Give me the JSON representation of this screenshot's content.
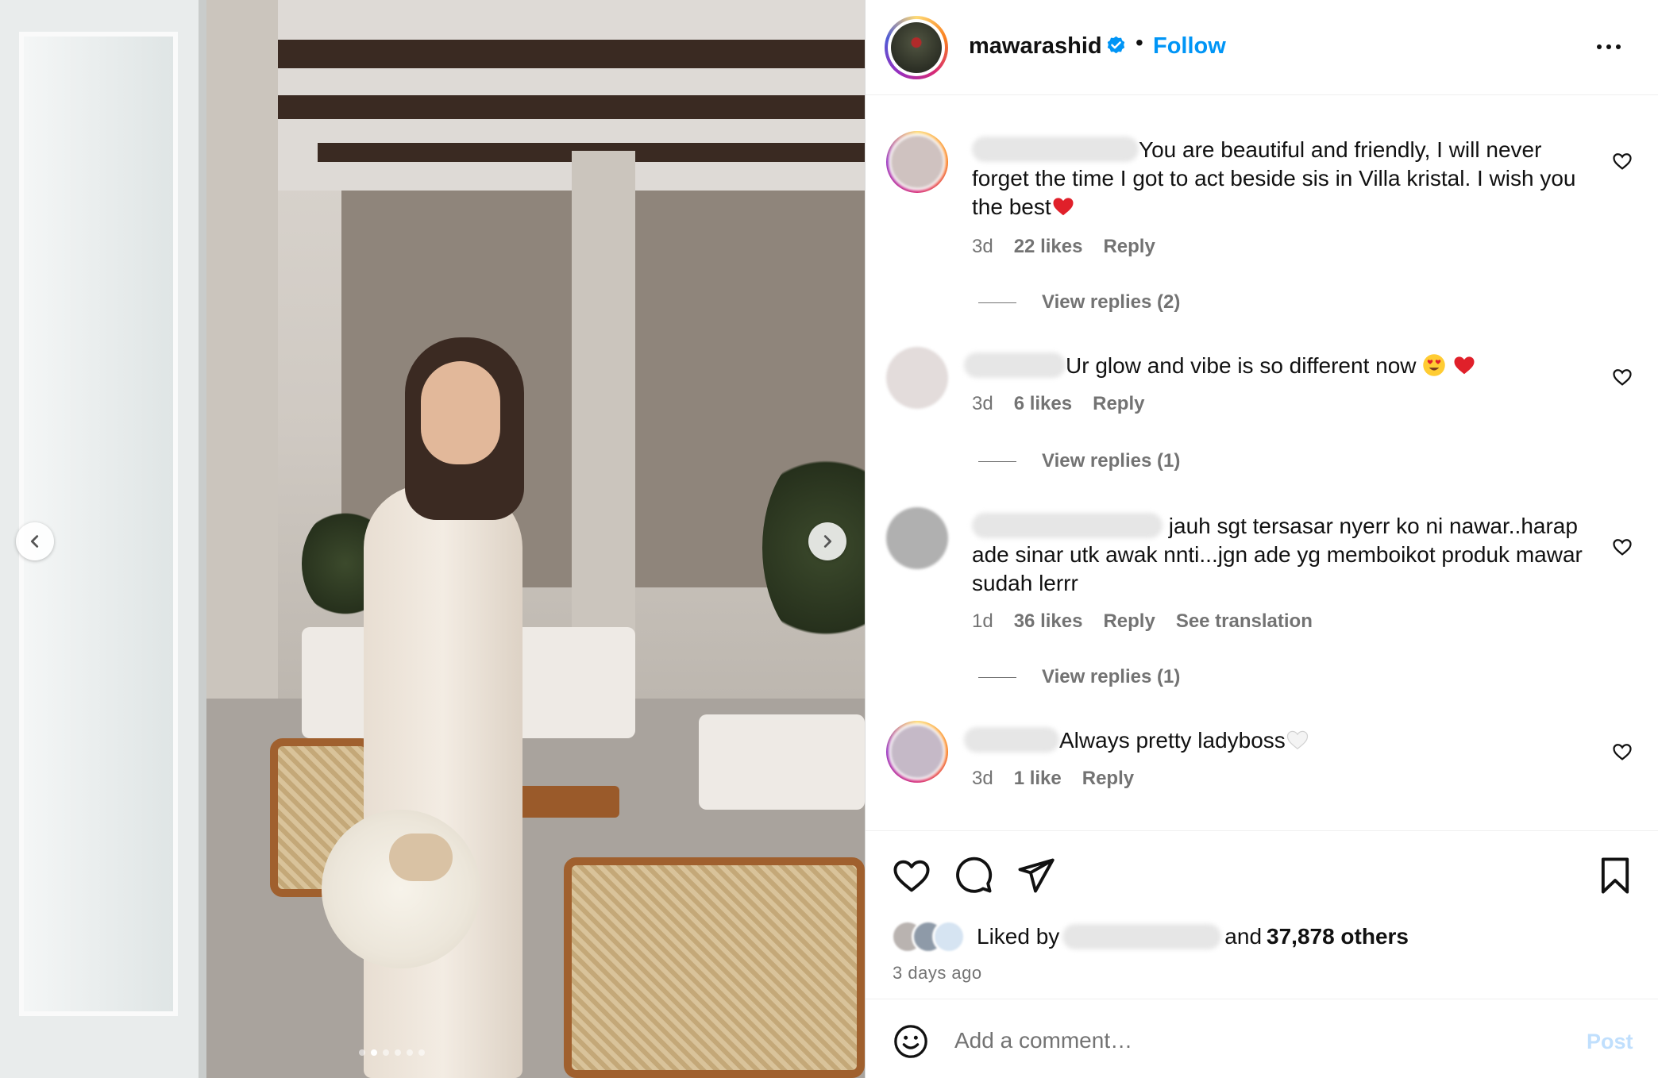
{
  "post": {
    "username": "mawarashid",
    "separator": "•",
    "follow_label": "Follow"
  },
  "comments": [
    {
      "text": "You are beautiful and friendly, I will never forget the time I got to act beside sis in Villa kristal. I wish you the best",
      "time": "3d",
      "likes": "22 likes",
      "reply": "Reply",
      "view_replies": "View replies (2)"
    },
    {
      "text": "Ur glow and vibe is so different now",
      "time": "3d",
      "likes": "6 likes",
      "reply": "Reply",
      "view_replies": "View replies (1)"
    },
    {
      "text": "jauh sgt tersasar nyerr ko ni nawar..harap ade sinar utk awak nnti...jgn ade yg memboikot produk mawar sudah lerrr",
      "time": "1d",
      "likes": "36 likes",
      "reply": "Reply",
      "see_translation": "See translation",
      "view_replies": "View replies (1)"
    },
    {
      "text": "Always pretty ladyboss",
      "time": "3d",
      "likes": "1 like",
      "reply": "Reply"
    }
  ],
  "likes_summary": {
    "liked_by": "Liked by",
    "and": "and",
    "others": "37,878 others"
  },
  "time_ago": "3 days ago",
  "comment_box": {
    "placeholder": "Add a comment…",
    "post_label": "Post"
  },
  "icons": {
    "like": "heart-outline-icon",
    "comment": "speech-bubble-icon",
    "share": "paper-plane-icon",
    "save": "bookmark-icon",
    "emoji": "smiley-icon",
    "more": "more-horizontal-icon",
    "verified": "verified-badge-icon"
  },
  "colors": {
    "accent": "#0095f6",
    "post_disabled": "#c0dffd",
    "muted": "#737373"
  },
  "carousel": {
    "slide_count": 6,
    "active_index": 1
  }
}
